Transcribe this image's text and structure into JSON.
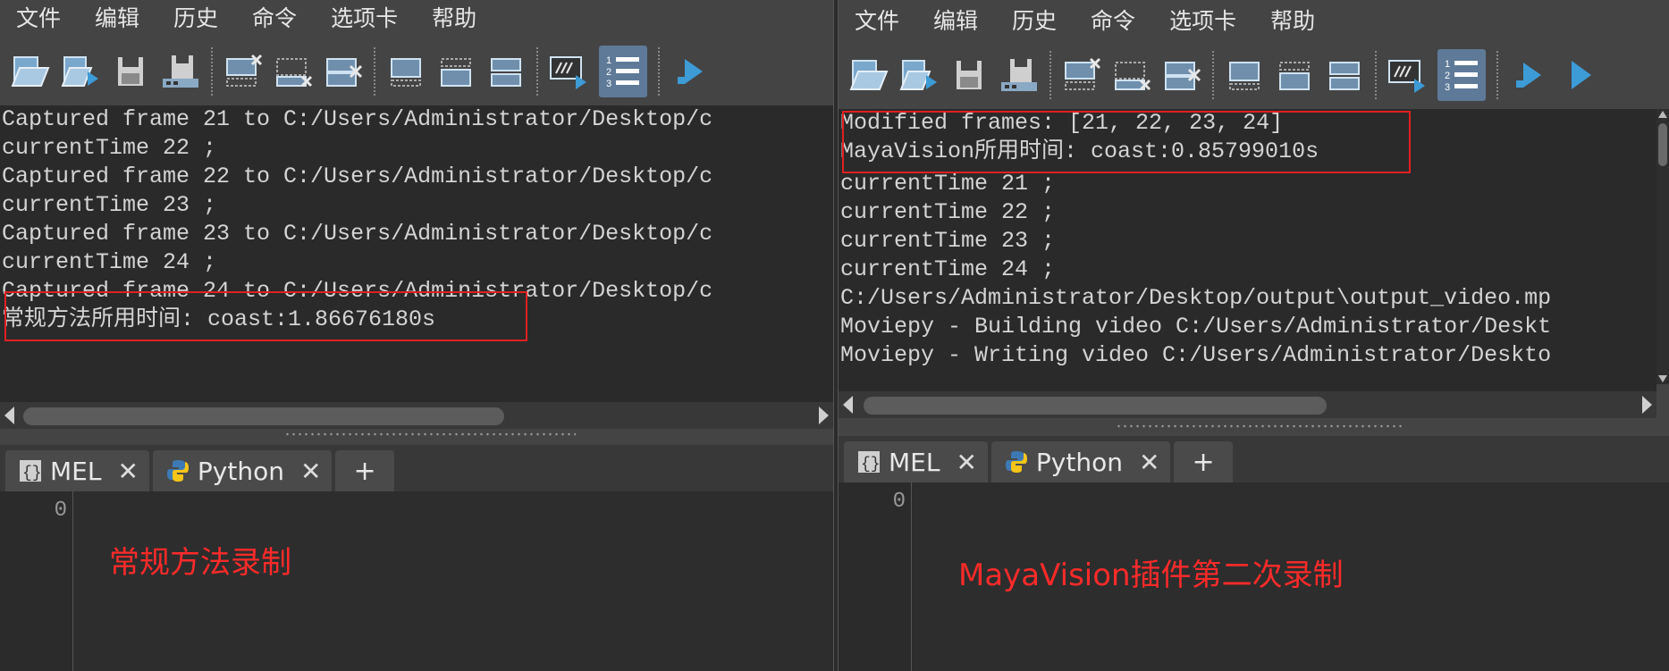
{
  "left": {
    "menu": [
      "文件",
      "编辑",
      "历史",
      "命令",
      "选项卡",
      "帮助"
    ],
    "output_lines": [
      "Captured frame 21 to C:/Users/Administrator/Desktop/c",
      "currentTime 22 ;",
      "Captured frame 22 to C:/Users/Administrator/Desktop/c",
      "currentTime 23 ;",
      "Captured frame 23 to C:/Users/Administrator/Desktop/c",
      "currentTime 24 ;",
      "Captured frame 24 to C:/Users/Administrator/Desktop/c",
      "常规方法所用时间: coast:1.86676180s"
    ],
    "tabs": [
      {
        "label": "MEL",
        "close": "✕"
      },
      {
        "label": "Python",
        "close": "✕"
      }
    ],
    "add_tab": "+",
    "line_number": "0",
    "caption": "常规方法录制"
  },
  "right": {
    "menu": [
      "文件",
      "编辑",
      "历史",
      "命令",
      "选项卡",
      "帮助"
    ],
    "output_lines": [
      "Modified frames: [21, 22, 23, 24]",
      "MayaVision所用时间: coast:0.85799010s",
      "currentTime 21 ;",
      "currentTime 22 ;",
      "currentTime 23 ;",
      "currentTime 24 ;",
      "C:/Users/Administrator/Desktop/output\\output_video.mp",
      "Moviepy - Building video C:/Users/Administrator/Deskt",
      "Moviepy - Writing video C:/Users/Administrator/Deskto"
    ],
    "tabs": [
      {
        "label": "MEL",
        "close": "✕"
      },
      {
        "label": "Python",
        "close": "✕"
      }
    ],
    "add_tab": "+",
    "line_number": "0",
    "caption": "MayaVision插件第二次录制"
  },
  "colors": {
    "highlight": "#e02020",
    "caption": "#ff2a2a",
    "active_button": "#5e7a98",
    "accent_icon": "#3d9bd6"
  },
  "toolbar_icons": [
    "open-script-icon",
    "source-script-icon",
    "save-script-icon",
    "save-to-shelf-icon",
    "clear-history-icon",
    "clear-input-icon",
    "clear-all-icon",
    "show-history-icon",
    "show-input-icon",
    "show-both-icon",
    "echo-all-icon",
    "line-numbers-icon",
    "execute-icon",
    "execute-all-icon"
  ]
}
